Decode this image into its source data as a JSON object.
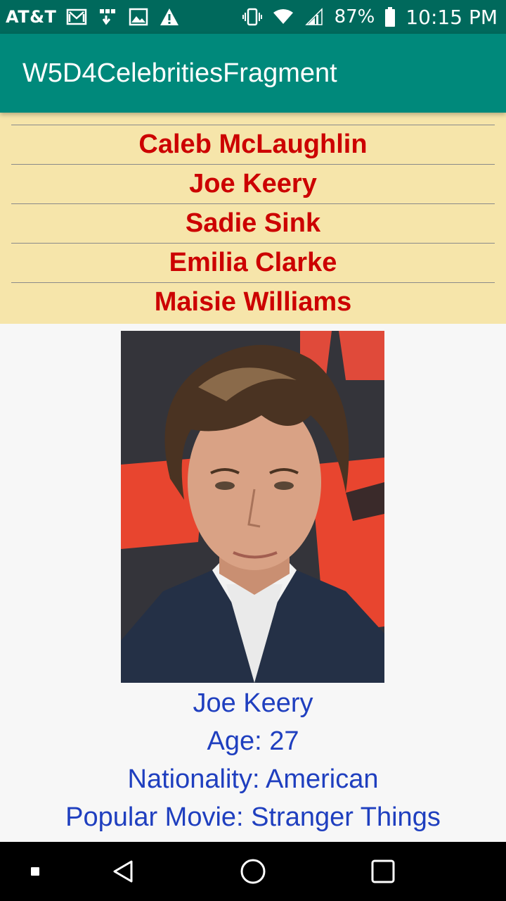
{
  "status_bar": {
    "carrier": "AT&T",
    "battery_percent": "87%",
    "time": "10:15 PM",
    "icons": [
      "gmail-icon",
      "usb-debug-icon",
      "image-icon",
      "warning-icon",
      "vibrate-icon",
      "wifi-icon",
      "signal-icon",
      "battery-icon"
    ]
  },
  "app_bar": {
    "title": "W5D4CelebritiesFragment",
    "color": "#00897b"
  },
  "celebrity_list": {
    "items": [
      {
        "name": "Caleb McLaughlin"
      },
      {
        "name": "Joe Keery"
      },
      {
        "name": "Sadie Sink"
      },
      {
        "name": "Emilia Clarke"
      },
      {
        "name": "Maisie Williams"
      }
    ],
    "text_color": "#cc0000",
    "background": "#f6e5aa"
  },
  "detail": {
    "name": "Joe Keery",
    "age": "Age: 27",
    "nationality": "Nationality: American",
    "popular_movie": "Popular Movie: Stranger Things",
    "text_color": "#1f3fbf"
  },
  "nav_bar": {
    "icons": [
      "recent-dot-icon",
      "back-icon",
      "home-icon",
      "overview-icon"
    ]
  }
}
